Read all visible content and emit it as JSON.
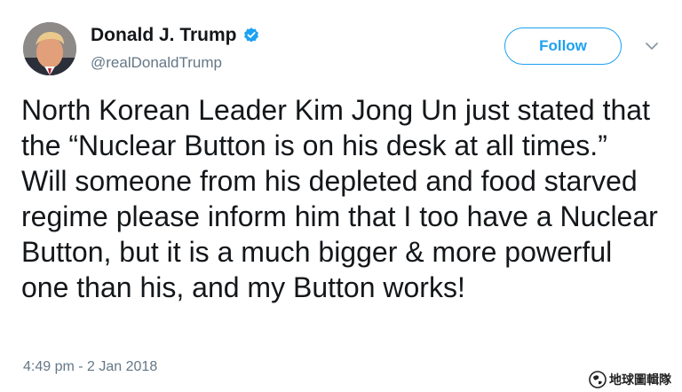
{
  "tweet": {
    "author": {
      "display_name": "Donald J. Trump",
      "handle": "@realDonaldTrump",
      "verified": true
    },
    "follow_label": "Follow",
    "text": "North Korean Leader Kim Jong Un just stated that the “Nuclear Button is on his desk at all times.” Will someone from his depleted and food starved regime please inform him that I too have a Nuclear Button, but it is a much bigger & more powerful one than his, and my Button works!",
    "timestamp": "4:49 pm - 2 Jan 2018"
  },
  "watermark": {
    "text": "地球圖輯隊"
  },
  "icons": {
    "verified": "verified-badge-icon",
    "menu": "chevron-down-icon",
    "watermark_logo": "globe-logo-icon"
  },
  "colors": {
    "brand_blue": "#1da1f2",
    "text_primary": "#14171a",
    "text_secondary": "#657786"
  }
}
